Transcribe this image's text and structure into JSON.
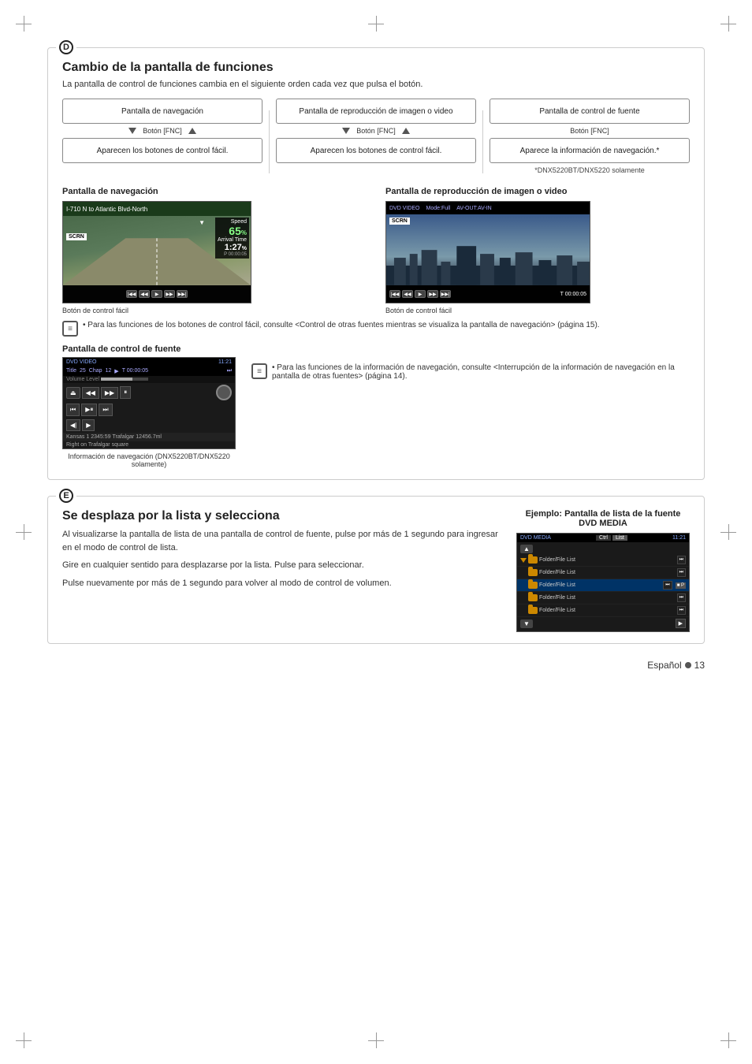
{
  "crosshairs": [
    "top-left",
    "top-right",
    "top-center",
    "bottom-left",
    "bottom-right",
    "bottom-center",
    "left-center",
    "right-center"
  ],
  "section_d": {
    "label": "D",
    "title": "Cambio de la pantalla de funciones",
    "subtitle": "La pantalla de control de funciones cambia en el siguiente orden cada vez que pulsa el botón.",
    "flow_items": [
      {
        "label": "Pantalla de navegación",
        "fnc_label": "Botón [FNC]",
        "bottom_label": "Aparecen los botones de control fácil."
      },
      {
        "label": "Pantalla de reproducción de imagen o video",
        "fnc_label": "Botón [FNC]",
        "bottom_label": "Aparecen los botones de control fácil."
      },
      {
        "label": "Pantalla de control de fuente",
        "fnc_label": "Botón [FNC]",
        "bottom_label": "Aparece la información de navegación.*"
      }
    ],
    "dnx_note": "*DNX5220BT/DNX5220 solamente",
    "nav_screen_label": "Pantalla de navegación",
    "video_screen_label": "Pantalla de reproducción de imagen o video",
    "nav_top_text": "I-710 N to Atlantic Blvd-North",
    "nav_speed": "Speed\n65%",
    "nav_arrival": "Arrival Time\n1:27%",
    "nav_position": "P 00:00:05",
    "nav_ctrl_label": "Botón de control fácil",
    "video_top_items": [
      "DVD VIDEO",
      "Mode:Full",
      "AV-OUT:AV-IN"
    ],
    "video_time": "T 00:00:05",
    "video_ctrl_label": "Botón de control fácil",
    "note1_text": "• Para las funciones de los botones de control fácil, consulte <Control de otras fuentes mientras se visualiza la pantalla de navegación> (página 15).",
    "source_screen_label": "Pantalla de control de fuente",
    "source_top_items": [
      "DVD VIDEO",
      "11:21"
    ],
    "source_row1": "Title  25  Chap  12  ▶  T 00:00:05",
    "source_row2": "Volume Level",
    "nav_info_label": "Información de navegación\n(DNX5220BT/DNX5220 solamente)",
    "note2_text": "• Para las funciones de la información de navegación, consulte <Interrupción de la información de navegación en la pantalla de otras fuentes> (página 14)."
  },
  "section_e": {
    "label": "E",
    "title": "Se desplaza por la lista y selecciona",
    "body_text_1": "Al visualizarse la pantalla de lista de una pantalla de control de fuente, pulse por más de 1 segundo para ingresar en el modo de control de lista.",
    "body_text_2": "Gire en cualquier sentido para desplazarse por la lista. Pulse para seleccionar.",
    "body_text_3": "Pulse nuevamente por más de 1 segundo para volver al modo de control de volumen.",
    "example_title": "Ejemplo: Pantalla de lista de la fuente DVD MEDIA",
    "dvd_media_title": "DVD MEDIA",
    "dvd_media_top_right": "11:21",
    "dvd_media_tabs": [
      "Ctrl",
      "List"
    ],
    "folder_rows": [
      "Folder/File List",
      "Folder/File List",
      "Folder/File List",
      "Folder/File List",
      "Folder/File List"
    ]
  },
  "page_footer": {
    "lang": "Español",
    "page": "13"
  }
}
